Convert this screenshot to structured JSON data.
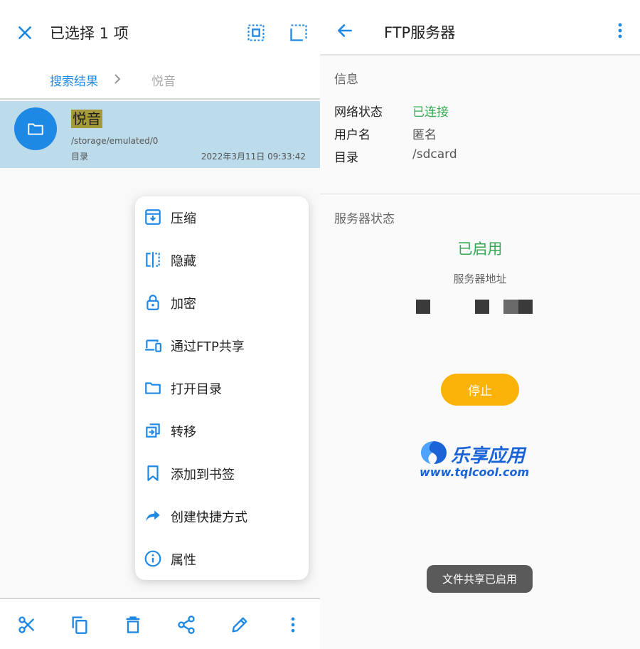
{
  "left": {
    "header": {
      "title": "已选择 1 项"
    },
    "breadcrumb": {
      "items": [
        "搜索结果",
        "悦音"
      ]
    },
    "file_row": {
      "name": "悦音",
      "path": "/storage/emulated/0",
      "type": "目录",
      "date": "2022年3月11日 09:33:42"
    },
    "context_menu": {
      "items": [
        {
          "label": "压缩",
          "icon": "archive-icon"
        },
        {
          "label": "隐藏",
          "icon": "hide-icon"
        },
        {
          "label": "加密",
          "icon": "lock-icon"
        },
        {
          "label": "通过FTP共享",
          "icon": "devices-icon"
        },
        {
          "label": "打开目录",
          "icon": "folder-icon"
        },
        {
          "label": "转移",
          "icon": "transfer-icon"
        },
        {
          "label": "添加到书签",
          "icon": "bookmark-icon"
        },
        {
          "label": "创建快捷方式",
          "icon": "shortcut-icon"
        },
        {
          "label": "属性",
          "icon": "info-icon"
        }
      ]
    },
    "bottom_bar": {
      "icons": [
        "cut-icon",
        "copy-icon",
        "delete-icon",
        "share-icon",
        "edit-icon",
        "more-icon"
      ]
    }
  },
  "right": {
    "header": {
      "title": "FTP服务器"
    },
    "info": {
      "heading": "信息",
      "rows": [
        {
          "key": "网络状态",
          "value": "已连接"
        },
        {
          "key": "用户名",
          "value": "匿名"
        },
        {
          "key": "目录",
          "value": "/sdcard"
        }
      ]
    },
    "server": {
      "heading": "服务器状态",
      "status": "已启用",
      "address_label": "服务器地址",
      "stop_label": "停止"
    },
    "watermark": {
      "title": "乐享应用",
      "url": "www.tqlcool.com"
    },
    "toast": "文件共享已启用"
  },
  "colors": {
    "accent": "#1e88e5",
    "selected_row": "#bcdcec",
    "status_green": "#34a853",
    "stop_button": "#fbb308",
    "toast_bg": "#5a5a5a"
  }
}
